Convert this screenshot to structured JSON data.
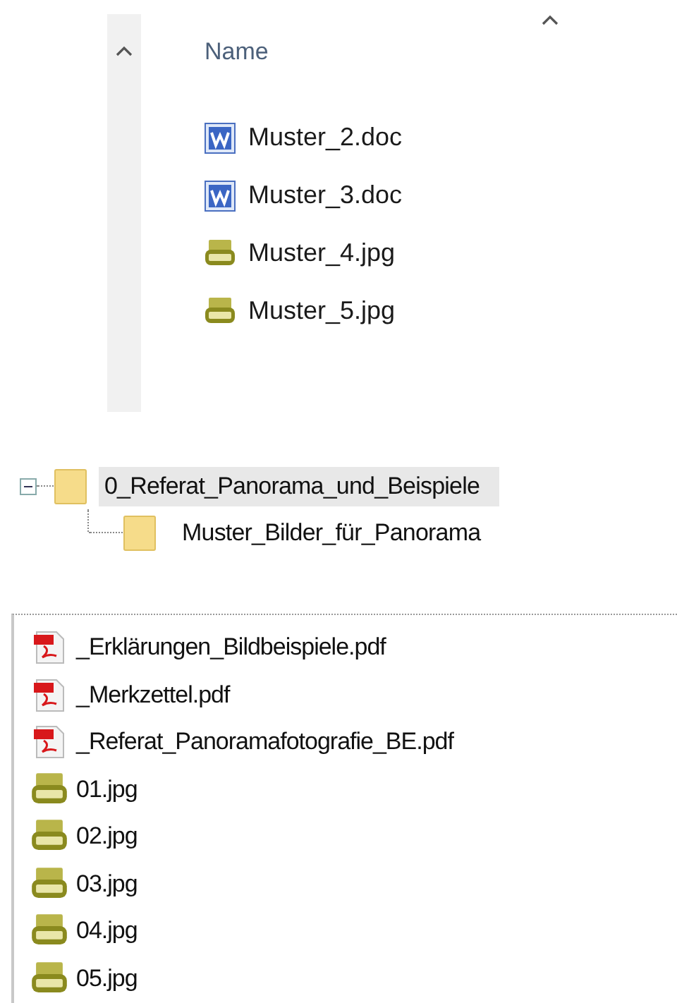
{
  "details_pane": {
    "column_header": "Name",
    "files": [
      {
        "name": "Muster_2.doc",
        "kind": "doc"
      },
      {
        "name": "Muster_3.doc",
        "kind": "doc"
      },
      {
        "name": "Muster_4.jpg",
        "kind": "jpg"
      },
      {
        "name": "Muster_5.jpg",
        "kind": "jpg"
      }
    ]
  },
  "folder_tree": {
    "items": [
      {
        "label": "0_Referat_Panorama_und_Beispiele",
        "selected": true,
        "expanded": true,
        "children": [
          {
            "label": "Muster_Bilder_für_Panorama",
            "selected": false
          }
        ]
      }
    ]
  },
  "file_list": {
    "files": [
      {
        "name": "_Erklärungen_Bildbeispiele.pdf",
        "kind": "pdf"
      },
      {
        "name": "_Merkzettel.pdf",
        "kind": "pdf"
      },
      {
        "name": "_Referat_Panoramafotografie_BE.pdf",
        "kind": "pdf"
      },
      {
        "name": "01.jpg",
        "kind": "jpg"
      },
      {
        "name": "02.jpg",
        "kind": "jpg"
      },
      {
        "name": "03.jpg",
        "kind": "jpg"
      },
      {
        "name": "04.jpg",
        "kind": "jpg"
      },
      {
        "name": "05.jpg",
        "kind": "jpg"
      }
    ]
  }
}
